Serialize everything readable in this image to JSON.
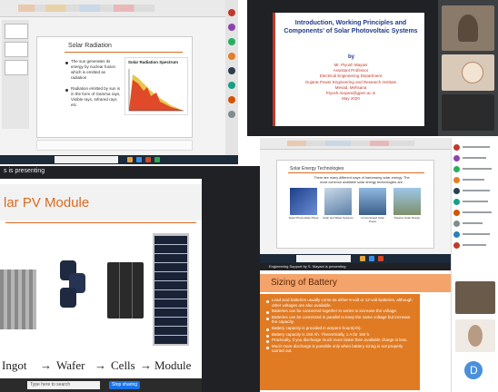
{
  "colors": {
    "accent_orange": "#d96a1f",
    "ppt_red": "#c0392b",
    "taskbar": "#1c2a3a",
    "meet_blue": "#1a73e8",
    "dark_bg": "#202124",
    "panel_gray": "#3c4043",
    "battery_orange": "#e07b24"
  },
  "top_left": {
    "slide_title": "Solar Radiation",
    "bullets": [
      "The sun generates its energy by nuclear fusion which is emitted as radiation",
      "Radiation emitted by sun is in the form of Gamma rays, Visible rays, Infrared rays etc."
    ],
    "chart_title": "Solar Radiation Spectrum",
    "footer_text": "Engineering Support by S. Mayani is presenting"
  },
  "top_right": {
    "title": "Introduction, Working Principles and Components' of Solar Photovoltaic Systems",
    "by": "by",
    "author": "Mr. Piyush Mayani",
    "role": "Assistant Professor",
    "dept": "Electrical Engineering Department",
    "institute": "Gujarat Power Engineering and Research Institute",
    "place": "Mevad, Mehsana",
    "email": "Piyush.mayani@gperi.ac.in",
    "date": "May 2020"
  },
  "presenting_label": "s is presenting",
  "mid_right": {
    "slide_title": "Solar Energy Technologies",
    "intro": "There are many different ways of harnessing solar energy. The most common available solar energy technologies are:",
    "tech_labels": [
      "Solar Photovoltaic Panel",
      "Solar Hot Water Systems",
      "Concentrated Solar Power",
      "Passive Solar Design"
    ]
  },
  "bottom_left": {
    "title": "lar PV Module",
    "flow": [
      "Ingot",
      "Wafer",
      "Cells",
      "Module"
    ],
    "search_placeholder": "Type here to search",
    "stop_button": "Stop sharing"
  },
  "bottom_right": {
    "presenting": "Engineering Support by S. Mayani is presenting",
    "title": "Sizing of Battery",
    "bullets": [
      "Lead acid batteries usually come as either 6-volt or 12-volt batteries, although other voltages are also available.",
      "Batteries can be connected together in series to increase the voltage.",
      "Batteries can be connected in parallel to keep the same voltage but increase the capacity.",
      "Battery capacity is provided in ampere-hours(Ah).",
      "Battery capacity is 150 Ah. Theoretically, 1 A for 150 h.",
      "Practically, if you discharge much more faster then available charge is less.",
      "Much more discharge is possible only when battery sizing is not properly carried out."
    ]
  },
  "participant_tile": {
    "initial": "D"
  }
}
